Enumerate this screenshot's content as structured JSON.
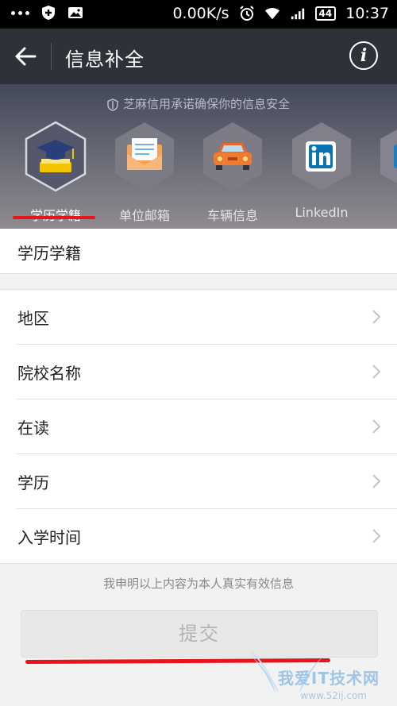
{
  "status_bar": {
    "speed": "0.00K/s",
    "battery": "44",
    "time": "10:37"
  },
  "header": {
    "title": "信息补全"
  },
  "banner": {
    "notice": "芝麻信用承诺确保你的信息安全",
    "categories": [
      {
        "label": "学历学籍",
        "icon": "graduation-cap-icon"
      },
      {
        "label": "单位邮箱",
        "icon": "envelope-icon"
      },
      {
        "label": "车辆信息",
        "icon": "car-icon"
      },
      {
        "label": "LinkedIn",
        "icon": "linkedin-icon"
      }
    ],
    "active_index": 0
  },
  "section_title": "学历学籍",
  "form_rows": [
    {
      "label": "地区"
    },
    {
      "label": "院校名称"
    },
    {
      "label": "在读"
    },
    {
      "label": "学历"
    },
    {
      "label": "入学时间"
    }
  ],
  "declaration": "我申明以上内容为本人真实有效信息",
  "submit_label": "提交",
  "watermark": {
    "text": "我爱IT技术网",
    "url": "www.52ij.com"
  },
  "colors": {
    "header_bg": "#2e3138",
    "accent_red": "#e4151b"
  }
}
